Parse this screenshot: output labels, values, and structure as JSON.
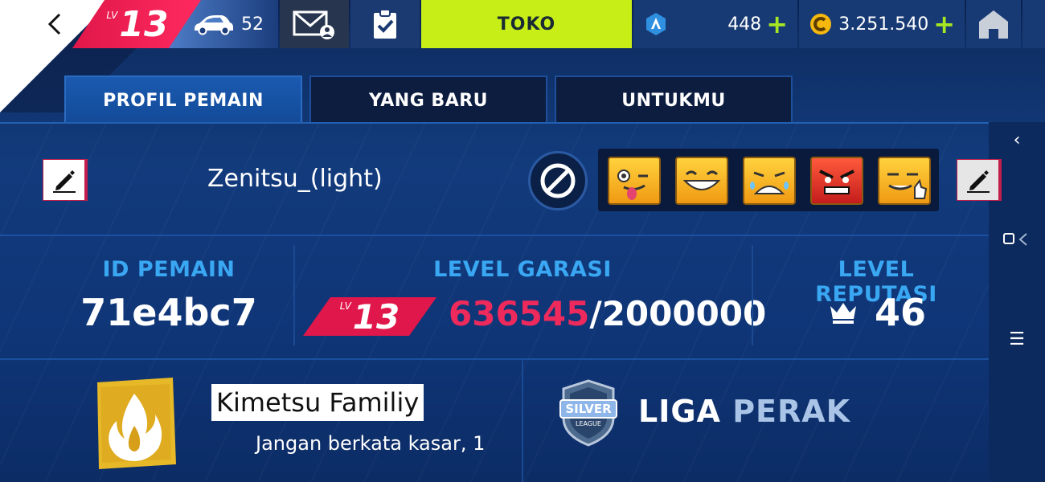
{
  "topbar": {
    "level_prefix": "LV",
    "level": "13",
    "cars_count": "52",
    "shop_label": "TOKO",
    "tokens": "448",
    "credits": "3.251.540",
    "plus_symbol": "+",
    "icons": [
      "back-arrow-icon",
      "car-icon",
      "mail-profile-icon",
      "clipboard-check-icon",
      "token-icon",
      "credit-coin-icon",
      "home-icon"
    ]
  },
  "tabs": [
    {
      "label": "PROFIL PEMAIN",
      "active": true
    },
    {
      "label": "YANG BARU",
      "active": false
    },
    {
      "label": "UNTUKMU",
      "active": false
    }
  ],
  "profile": {
    "player_name": "Zenitsu_(light)",
    "emotes": [
      "wink-tongue-emote",
      "grin-emote",
      "crying-emote",
      "angry-emote",
      "smug-thumbs-emote"
    ]
  },
  "stats": {
    "id_label": "ID PEMAIN",
    "player_id": "71e4bc7",
    "garage_label": "LEVEL GARASI",
    "garage_level_prefix": "LV",
    "garage_level": "13",
    "xp_current": "636545",
    "xp_separator": "/",
    "xp_total": "2000000",
    "rep_label": "LEVEL REPUTASI",
    "rep_level": "46"
  },
  "club": {
    "name": "Kimetsu Familiy",
    "motto": "Jangan berkata kasar, 1"
  },
  "league": {
    "badge_text": "SILVER",
    "badge_subtext": "LEAGUE",
    "name_word1": "LIGA",
    "name_word2": "PERAK"
  },
  "side_nav": {
    "collapse": "‹",
    "menu": "☰"
  },
  "colors": {
    "accent_pink": "#e0174a",
    "shop_green": "#c7ef17",
    "label_blue": "#3aa7f2"
  }
}
